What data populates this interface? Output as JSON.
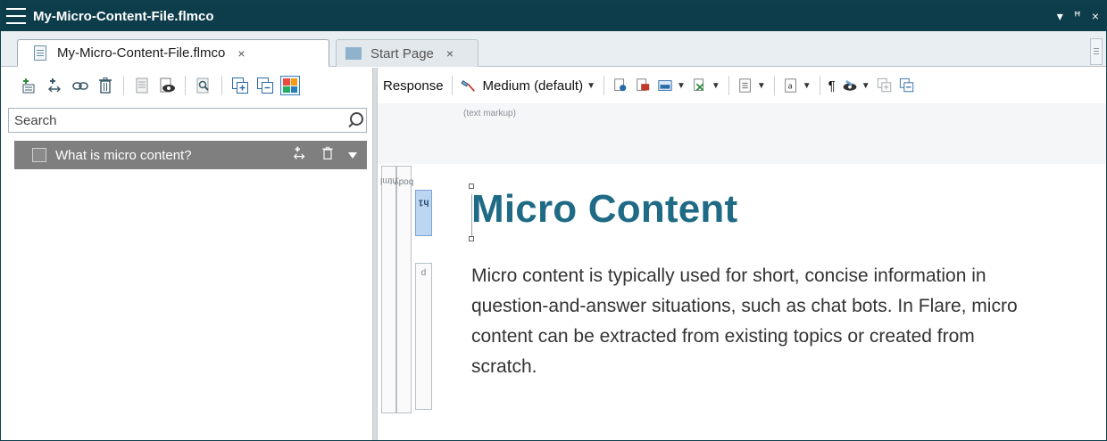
{
  "window": {
    "title": "My-Micro-Content-File.flmco",
    "controls": [
      "▾",
      "ꟸ",
      "×"
    ]
  },
  "tabs": [
    {
      "label": "My-Micro-Content-File.flmco",
      "close": "×",
      "active": true
    },
    {
      "label": "Start Page",
      "close": "×",
      "active": false
    }
  ],
  "left_pane": {
    "toolbar_icons": [
      "add-phrase-icon",
      "add-response-icon",
      "link-icon",
      "delete-icon",
      "document-icon",
      "preview-icon",
      "find-icon",
      "expand-all-icon",
      "collapse-all-icon",
      "tile-view-icon"
    ],
    "search": {
      "placeholder": "Search",
      "value": ""
    },
    "items": [
      {
        "label": "What is micro content?",
        "checked": false
      }
    ]
  },
  "right_pane": {
    "toolbar": {
      "response_label": "Response",
      "style_label": "Medium (default)",
      "pilcrow": "¶"
    },
    "markup_label": "(text markup)",
    "tags": [
      "html",
      "body",
      "h1",
      "p"
    ],
    "document": {
      "heading": "Micro Content",
      "paragraph": "Micro content is typically used for short, concise information in question-and-answer situations, such as chat bots. In Flare, micro content can be extracted from existing topics or created from scratch."
    }
  },
  "colors": {
    "titlebar": "#0d3c4a",
    "heading": "#1f6b86",
    "selected_row": "#7f7f7f",
    "h1_tag": "#bcd6f2"
  }
}
